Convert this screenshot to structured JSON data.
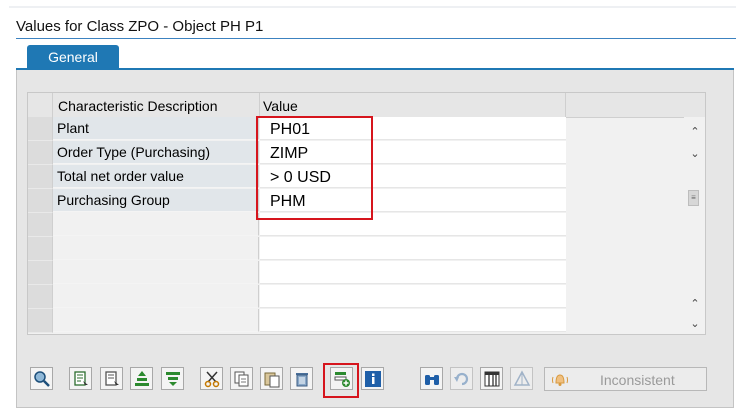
{
  "section": {
    "title": "Values for Class ZPO - Object PH P1"
  },
  "tabs": [
    {
      "label": "General"
    }
  ],
  "table": {
    "columns": [
      "Characteristic Description",
      "Value"
    ],
    "rows": [
      {
        "description": "Plant",
        "value": "PH01"
      },
      {
        "description": "Order Type (Purchasing)",
        "value": "ZIMP"
      },
      {
        "description": "Total net order value",
        "value": "> 0  USD"
      },
      {
        "description": "Purchasing Group",
        "value": "PHM"
      },
      {
        "description": "",
        "value": ""
      },
      {
        "description": "",
        "value": ""
      },
      {
        "description": "",
        "value": ""
      },
      {
        "description": "",
        "value": ""
      },
      {
        "description": "",
        "value": ""
      }
    ]
  },
  "toolbar": {
    "inconsistent_label": "Inconsistent",
    "icons": [
      "find-icon",
      "select-all-icon",
      "deselect-icon",
      "align-icon",
      "filter-icon",
      "cut-icon",
      "copy-icon",
      "paste-icon",
      "delete-icon",
      "insert-row-icon",
      "info-icon",
      "binoculars-icon",
      "undo-icon",
      "columns-icon",
      "triangle-icon",
      "bell-icon"
    ]
  },
  "colors": {
    "accent": "#1f78b4",
    "highlight": "#d6151d"
  }
}
